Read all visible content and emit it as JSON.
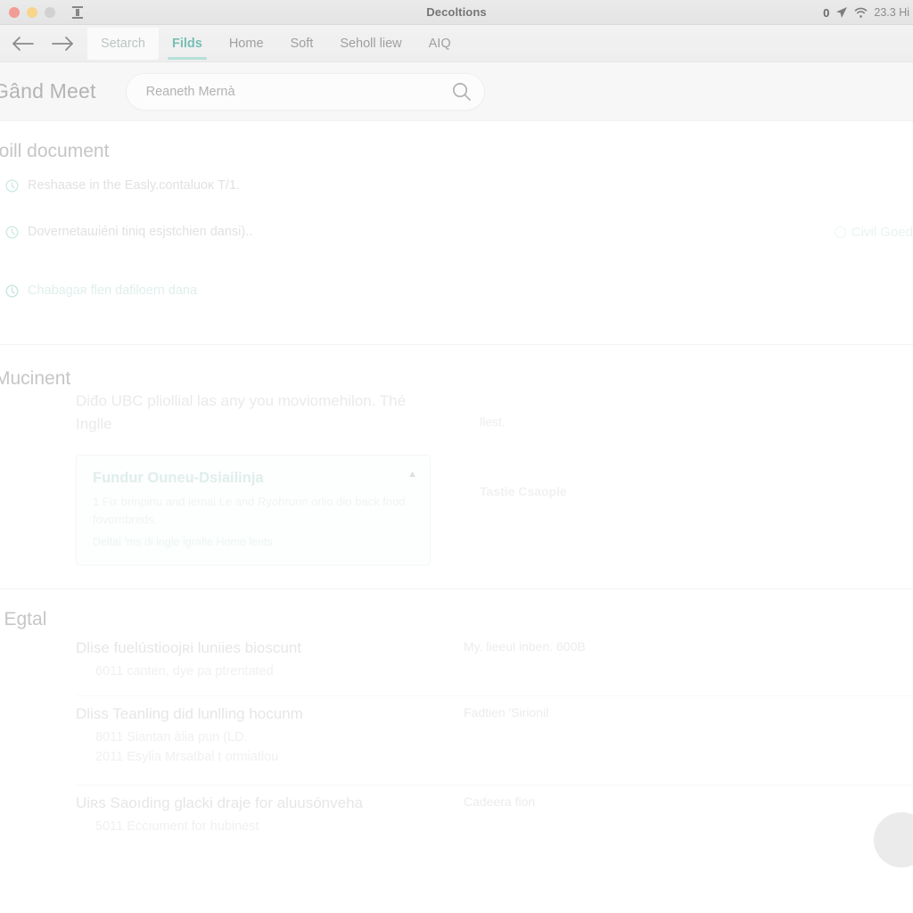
{
  "window": {
    "title": "Decoltions",
    "traffic_lights": [
      "close",
      "minimize",
      "maximize"
    ],
    "sidebar_toggle_icon": "menu-toggle-icon"
  },
  "statusbar": {
    "battery_icon": "battery-icon",
    "battery_label": "0",
    "location_icon": "location-arrow-icon",
    "wifi_icon": "wifi-icon",
    "clock": "23.3 Hi"
  },
  "navigation": {
    "back_icon": "arrow-left-icon",
    "forward_icon": "arrow-right-icon",
    "tabs": [
      {
        "label": "Setarch",
        "state": "boxed"
      },
      {
        "label": "Filds",
        "state": "active"
      },
      {
        "label": "Home",
        "state": "default"
      },
      {
        "label": "Soft",
        "state": "default"
      },
      {
        "label": "Seholl liew",
        "state": "default"
      },
      {
        "label": "AIQ",
        "state": "default"
      }
    ]
  },
  "header": {
    "brand": "Gând Meet",
    "search": {
      "value": "Reaneth Mernà",
      "placeholder": "Reaneth Mernà",
      "icon": "search-icon"
    }
  },
  "documents_section": {
    "title": "loill document",
    "notices": [
      {
        "icon": "clock-icon",
        "text": "Reshaase in the Easly.contaluoĸ T/1.",
        "badge": null
      },
      {
        "icon": "clock-icon",
        "text": "Dovernetaɯiéni tiniq esjstchien dansi)..",
        "badge": {
          "icon": "circle-check-icon",
          "label": "Civil Goed"
        }
      },
      {
        "icon": "clock-icon",
        "text": "Chabagaʀ flen dafiloern dana",
        "badge": null,
        "style": "teal"
      }
    ]
  },
  "document_section": {
    "title": "Mucinent",
    "lead": "Diđo UBC pliollial las any you moviomehilon. Thé Inglle",
    "card": {
      "title": "Fundur Ouneu-Dsiailinja",
      "body": "1 Fix brinpinu and iemai Le and Ryohrunn orlio dio back food fovornbreds.",
      "link": "Deltai 'ms di ingle igrafie Homo lents",
      "caret_icon": "chevron-up-icon"
    },
    "side_labels": [
      {
        "label": "llest.",
        "bold": false
      },
      {
        "label": "Tastie Csaople",
        "bold": true
      }
    ]
  },
  "legal_section": {
    "title": "i Egtal",
    "rows": [
      {
        "title": "Dlise fuelústioojʀi luniies bioscunt",
        "sub": "6011 canten, dye pa ptrentated",
        "sub2": null,
        "right": "My. lieeul inben. 600B"
      },
      {
        "title": "Dliss Teanling did lunlling hocunm",
        "sub": "8011 Siantan àlia pun (LD.",
        "sub2": "2011 Esylia Mrsatbal t ormiatlou",
        "right": "Fadtien 'Sirionil"
      },
      {
        "title": "Uiʀs Saoıding glacki draje for aluusónveha",
        "sub": "5011 Eccıument for hubinest",
        "sub2": null,
        "right": "Cadeera fion"
      }
    ]
  },
  "floating_action": {
    "icon": "avatar-circle-icon"
  },
  "colors": {
    "accent_teal": "#2f9e8f",
    "accent_teal_light": "#8fd0c6",
    "titlebar": "#d9d9d9",
    "tabbar": "#e8e8e8",
    "header_bg": "#f3f3f3",
    "body_bg": "#ffffff",
    "close_dot": "#ec6a5e",
    "min_dot": "#f3bf4f",
    "max_dot": "#b9b9b9",
    "text_muted": "#d2d2d2"
  }
}
